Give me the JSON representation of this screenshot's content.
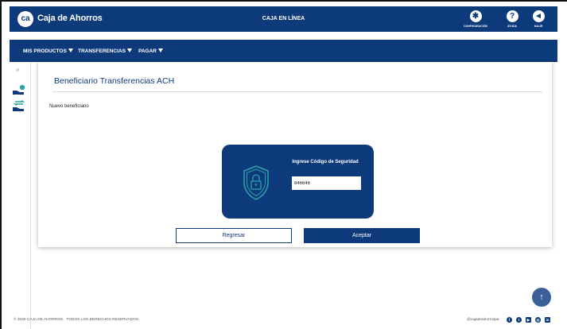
{
  "header": {
    "logo_text": "ca",
    "brand": "Caja de Ahorros",
    "center_title": "CAJA EN LÍNEA",
    "actions": [
      {
        "icon": "gear-icon",
        "glyph": "✱",
        "label": "CONFIGURACIÓN"
      },
      {
        "icon": "help-icon",
        "glyph": "?",
        "label": "AYUDA"
      },
      {
        "icon": "logout-icon",
        "glyph": "◄",
        "label": "SALIR"
      }
    ]
  },
  "menu": {
    "items": [
      "MIS PRODUCTOS",
      "TRANSFERENCIAS",
      "PAGAR"
    ]
  },
  "sidebar": {
    "collapse_glyph": "»"
  },
  "main": {
    "title": "Beneficiario Transferencias ACH",
    "subtitle": "Nuevo beneficiario",
    "security": {
      "label": "Ingrese Código de Seguridad",
      "value": "846646"
    },
    "buttons": {
      "back": "Regresar",
      "accept": "Aceptar"
    }
  },
  "scroll_top_glyph": "↑",
  "footer": {
    "copyright": "© 2020 CAJA DE AHORROS · TODOS LOS DERECHOS RESERVADOS",
    "handle": "@cajadeahorrospa",
    "social": [
      {
        "icon": "facebook-icon",
        "glyph": "f"
      },
      {
        "icon": "twitter-icon",
        "glyph": "t"
      },
      {
        "icon": "youtube-icon",
        "glyph": "▶"
      },
      {
        "icon": "instagram-icon",
        "glyph": "◎"
      },
      {
        "icon": "linkedin-icon",
        "glyph": "in"
      }
    ]
  },
  "colors": {
    "brand_blue": "#0d3a7a",
    "accent_teal": "#2ba6a6"
  }
}
